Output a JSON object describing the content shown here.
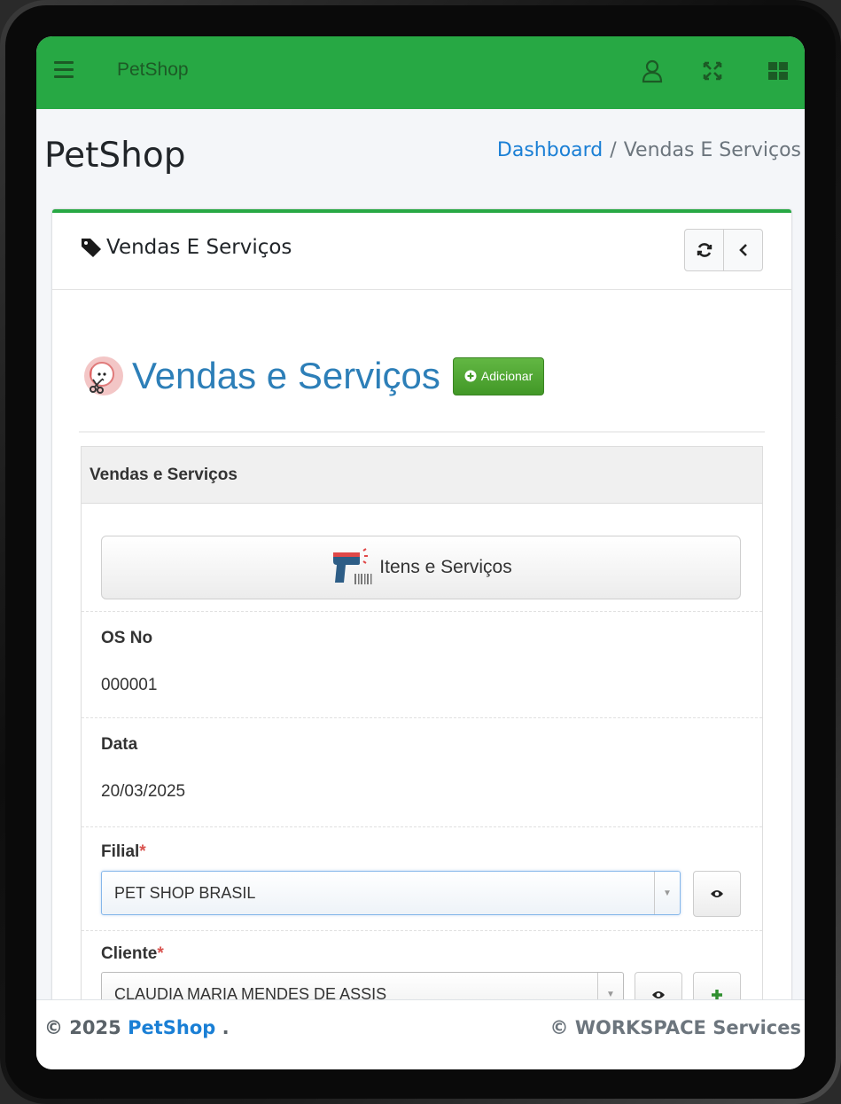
{
  "topbar": {
    "brand": "PetShop",
    "menu_icon": "hamburger-menu-icon",
    "icons": [
      "user-icon",
      "fullscreen-icon",
      "grid-apps-icon"
    ],
    "color": "#27a844"
  },
  "header": {
    "title": "PetShop",
    "breadcrumb": {
      "home": "Dashboard",
      "separator": "/",
      "current": "Vendas E Serviços"
    }
  },
  "card": {
    "title": "Vendas E Serviços",
    "title_icon": "tag-icon",
    "tools": [
      "refresh-icon",
      "collapse-left-icon"
    ]
  },
  "main": {
    "heading": "Vendas e Serviços",
    "heading_icon": "pet-grooming-icon",
    "add_button": "Adicionar",
    "add_icon": "plus-circle-icon"
  },
  "panel": {
    "title": "Vendas e Serviços",
    "items_button": "Itens e Serviços",
    "items_icon": "barcode-scanner-icon",
    "fields": {
      "os_label": "OS No",
      "os_value": "000001",
      "date_label": "Data",
      "date_value": "20/03/2025",
      "filial_label": "Filial",
      "filial_value": "PET SHOP BRASIL",
      "cliente_label": "Cliente",
      "cliente_value": "CLAUDIA MARIA MENDES DE ASSIS",
      "required_mark": "*"
    }
  },
  "footer": {
    "copyright_prefix": "© 2025",
    "brand": "PetShop",
    "suffix": ".",
    "right": "© WORKSPACE Services"
  }
}
